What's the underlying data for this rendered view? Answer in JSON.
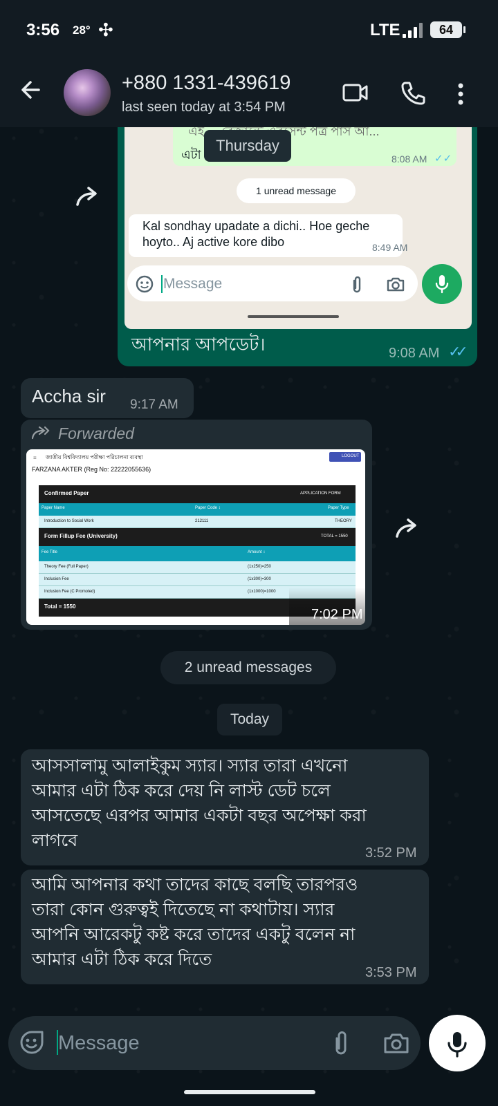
{
  "status_bar": {
    "time": "3:56",
    "temperature": "28°",
    "fan_icon": "fan-icon",
    "network": "LTE",
    "battery": "64"
  },
  "header": {
    "contact_name": "+880 1331-439619",
    "last_seen": "last seen today at 3:54 PM",
    "icons": [
      "back-arrow-icon",
      "video-call-icon",
      "phone-icon",
      "more-vert-icon"
    ]
  },
  "messages": {
    "screenshot_msg": {
      "inner": {
        "cut_text": "এই ... রেজাল্টে এবসেন্ট পত্র পাস আ...",
        "eta_text": "এটা",
        "time1": "8:08 AM",
        "date_chip": "Thursday",
        "unread_chip": "1 unread message",
        "incoming_text": "Kal sondhay upadate a dichi.. Hoe geche hoyto.. Aj active kore dibo",
        "time2": "8:49 AM",
        "input_placeholder": "Message"
      },
      "caption": "আপনার আপডেট।",
      "time": "9:08 AM"
    },
    "accha": {
      "text": "Accha sir",
      "time": "9:17 AM"
    },
    "forwarded": {
      "label": "Forwarded",
      "time": "7:02 PM",
      "doc": {
        "org": "জাতীয় বিশ্ববিদ্যালয় পরীক্ষা পরিচালনা ব্যবস্থা",
        "logout": "LOGOUT",
        "student": "FARZANA AKTER (Reg No: 22222055636)",
        "confirmed_paper": "Confirmed Paper",
        "application_form": "APPLICATION FORM",
        "paper_headers": [
          "Paper Name",
          "Paper Code ↕",
          "Paper Type"
        ],
        "paper_row": [
          "Introduction to Social Work",
          "212111",
          "THEORY"
        ],
        "fee_title": "Form Fillup Fee (University)",
        "fee_total_head": "TOTAL = 1550",
        "fee_headers": [
          "Fee Title",
          "Amount ↕"
        ],
        "fee_rows": [
          [
            "Theory Fee (Full Paper)",
            "(1x250)=250"
          ],
          [
            "Inclusion Fee",
            "(1x300)=300"
          ],
          [
            "Inclusion Fee (C Promoted)",
            "(1x1000)=1000"
          ]
        ],
        "total": "Total = 1550"
      }
    },
    "unread_chip": "2 unread messages",
    "today_chip": "Today",
    "msg1": {
      "lines": [
        "আসসালামু আলাইকুম স্যার। স্যার তারা এখনো",
        "আমার এটা ঠিক করে দেয় নি লাস্ট ডেট চলে",
        "আসতেছে এরপর আমার একটা বছর অপেক্ষা করা",
        "লাগবে"
      ],
      "time": "3:52 PM"
    },
    "msg2": {
      "lines": [
        "আমি আপনার কথা তাদের কাছে বলছি তারপরও",
        "তারা কোন গুরুত্বই দিতেছে না কথাটায়। স্যার",
        "আপনি আরেকটু কষ্ট করে তাদের একটু বলেন না",
        "আমার এটা ঠিক করে দিতে"
      ],
      "time": "3:53 PM"
    }
  },
  "composer": {
    "placeholder": "Message",
    "icons": [
      "sticker-icon",
      "attach-icon",
      "camera-icon",
      "mic-icon"
    ]
  },
  "colors": {
    "background": "#0b141a",
    "outgoing": "#005c4b",
    "incoming": "#202c33",
    "read_tick": "#53bdeb"
  }
}
